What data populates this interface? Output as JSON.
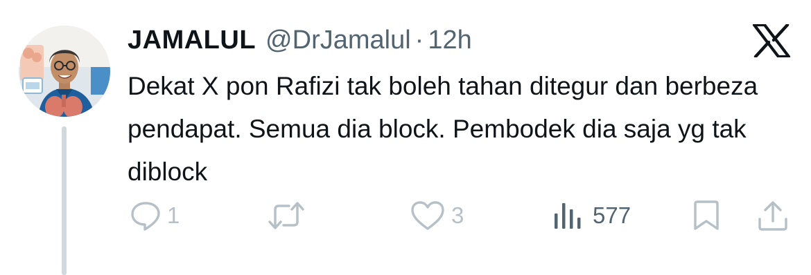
{
  "tweet": {
    "author_name": "JAMALUL",
    "handle": "@DrJamalul",
    "separator": "·",
    "timestamp": "12h",
    "text": "Dekat X pon Rafizi tak boleh tahan ditegur dan berbeza pendapat. Semua dia block. Pembodek dia saja yg tak diblock"
  },
  "actions": {
    "replies": "1",
    "retweets": "",
    "likes": "3",
    "views": "577"
  },
  "icons": {
    "platform": "x-logo-icon",
    "reply": "reply-icon",
    "retweet": "retweet-icon",
    "like": "heart-icon",
    "views": "views-icon",
    "bookmark": "bookmark-icon",
    "share": "share-icon"
  },
  "colors": {
    "text_primary": "#0f1419",
    "text_secondary": "#536471",
    "action_faded": "#b6c0c7",
    "thread_line": "#cfd9de"
  }
}
